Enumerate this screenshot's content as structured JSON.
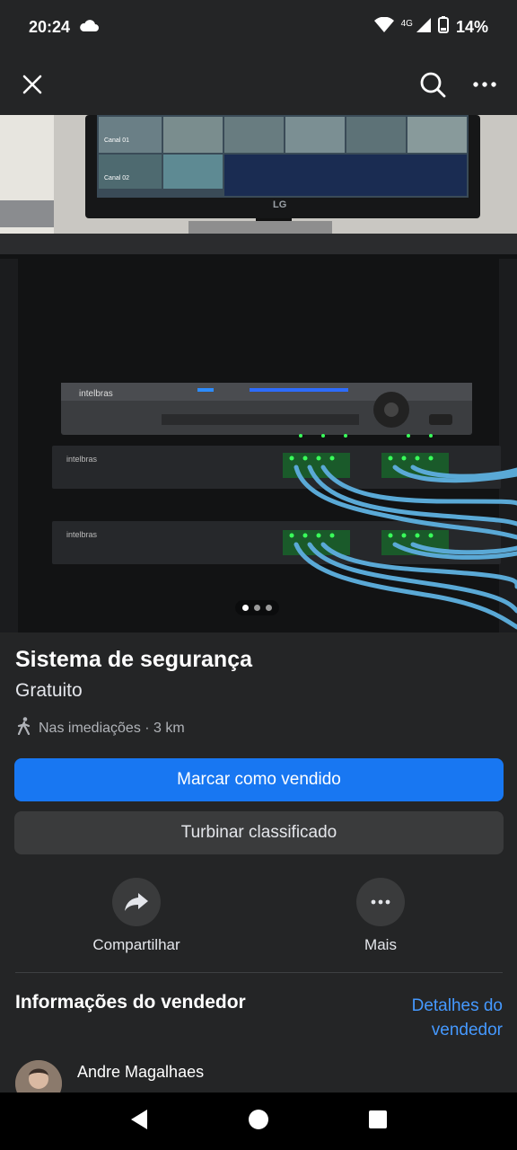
{
  "status": {
    "time": "20:24",
    "network": "4G",
    "battery": "14%",
    "icons": [
      "cloud-icon",
      "wifi-icon",
      "signal-icon",
      "battery-icon"
    ]
  },
  "header": {
    "close_icon": "close-icon",
    "search_icon": "search-icon",
    "more_icon": "more-icon"
  },
  "photo": {
    "screen_labels": [
      "Canal 01",
      "Canal 02"
    ],
    "monitor_brand": "LG",
    "device_brand": "intelbras",
    "pager_count": 3,
    "pager_active": 0
  },
  "listing": {
    "title": "Sistema de segurança",
    "price": "Gratuito",
    "location": "Nas imediações · 3 km"
  },
  "buttons": {
    "mark_sold": "Marcar como vendido",
    "boost": "Turbinar classificado"
  },
  "actions": {
    "share": "Compartilhar",
    "more": "Mais"
  },
  "seller": {
    "heading": "Informações do vendedor",
    "details_line1": "Detalhes do",
    "details_line2": "vendedor",
    "name": "Andre Magalhaes"
  },
  "colors": {
    "primary": "#1877f2",
    "link": "#4599ff",
    "background": "#242526"
  }
}
